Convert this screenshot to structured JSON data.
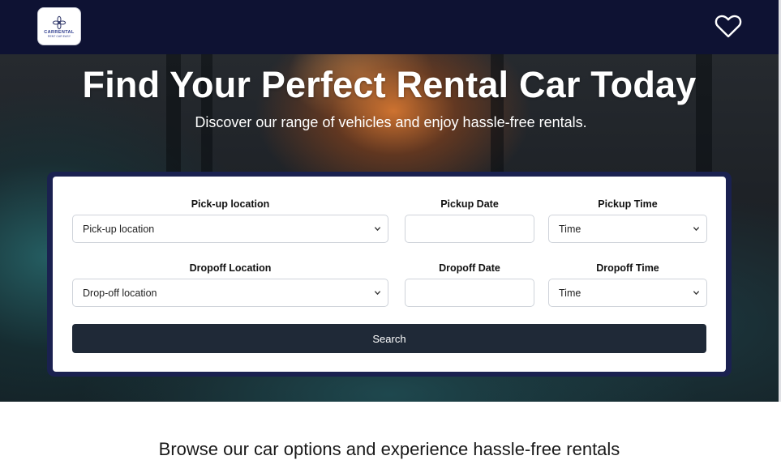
{
  "header": {
    "logo": {
      "brand": "CARRENTAL",
      "tagline": "RENT CAR EASY"
    },
    "icons": {
      "favorites": "heart-icon"
    },
    "colors": {
      "background": "#0e1233"
    }
  },
  "hero": {
    "title": "Find Your Perfect Rental Car Today",
    "subtitle": "Discover our range of vehicles and enjoy hassle-free rentals."
  },
  "search_form": {
    "pickup_location": {
      "label": "Pick-up location",
      "value": "Pick-up location"
    },
    "pickup_date": {
      "label": "Pickup Date",
      "value": ""
    },
    "pickup_time": {
      "label": "Pickup Time",
      "value": "Time"
    },
    "dropoff_location": {
      "label": "Dropoff Location",
      "value": "Drop-off location"
    },
    "dropoff_date": {
      "label": "Dropoff Date",
      "value": ""
    },
    "dropoff_time": {
      "label": "Dropoff Time",
      "value": "Time"
    },
    "search_button": "Search",
    "colors": {
      "frame": "#1a2150",
      "button": "#1f2937"
    }
  },
  "browse_section": {
    "heading": "Browse our car options and experience hassle-free rentals"
  }
}
